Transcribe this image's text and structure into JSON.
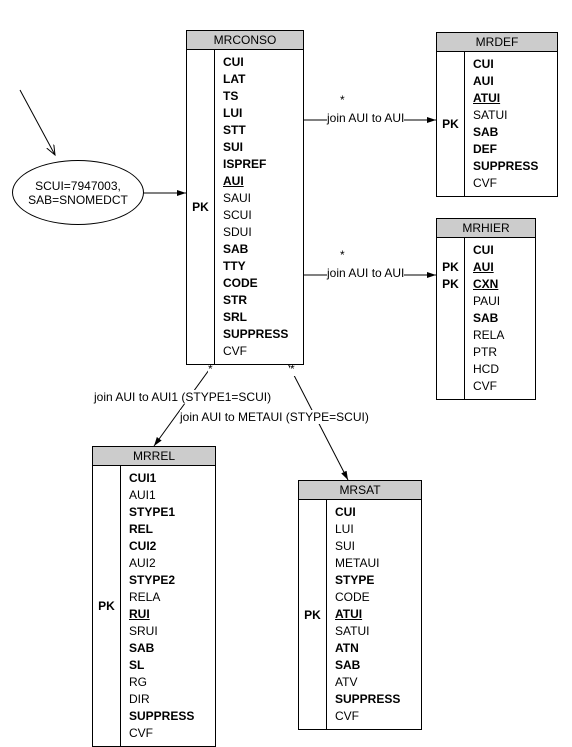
{
  "input": {
    "line1": "SCUI=7947003,",
    "line2": "SAB=SNOMEDCT"
  },
  "joins": {
    "mrdef": "join AUI to AUI",
    "mrhier": "join AUI to AUI",
    "mrrel": "join AUI to AUI1 (STYPE1=SCUI)",
    "mrsat": "join AUI to METAUI (STYPE=SCUI)"
  },
  "stars": {
    "top": "*",
    "mid": "*",
    "left": "*",
    "right": "*"
  },
  "entities": {
    "mrconso": {
      "title": "MRCONSO",
      "pk": "PK",
      "fields": [
        {
          "name": "CUI",
          "bold": true
        },
        {
          "name": "LAT",
          "bold": true
        },
        {
          "name": "TS",
          "bold": true
        },
        {
          "name": "LUI",
          "bold": true
        },
        {
          "name": "STT",
          "bold": true
        },
        {
          "name": "SUI",
          "bold": true
        },
        {
          "name": "ISPREF",
          "bold": true
        },
        {
          "name": "AUI",
          "bold": true,
          "underline": true
        },
        {
          "name": "SAUI"
        },
        {
          "name": "SCUI"
        },
        {
          "name": "SDUI"
        },
        {
          "name": "SAB",
          "bold": true
        },
        {
          "name": "TTY",
          "bold": true
        },
        {
          "name": "CODE",
          "bold": true
        },
        {
          "name": "STR",
          "bold": true
        },
        {
          "name": "SRL",
          "bold": true
        },
        {
          "name": "SUPPRESS",
          "bold": true
        },
        {
          "name": "CVF"
        }
      ]
    },
    "mrdef": {
      "title": "MRDEF",
      "pk": "PK",
      "fields": [
        {
          "name": "CUI",
          "bold": true
        },
        {
          "name": "AUI",
          "bold": true
        },
        {
          "name": "ATUI",
          "bold": true,
          "underline": true
        },
        {
          "name": "SATUI"
        },
        {
          "name": "SAB",
          "bold": true
        },
        {
          "name": "DEF",
          "bold": true
        },
        {
          "name": "SUPPRESS",
          "bold": true
        },
        {
          "name": "CVF"
        }
      ]
    },
    "mrhier": {
      "title": "MRHIER",
      "pk1": "PK",
      "pk2": "PK",
      "fields": [
        {
          "name": "CUI",
          "bold": true
        },
        {
          "name": "AUI",
          "bold": true,
          "underline": true
        },
        {
          "name": "CXN",
          "bold": true,
          "underline": true
        },
        {
          "name": "PAUI"
        },
        {
          "name": "SAB",
          "bold": true
        },
        {
          "name": "RELA"
        },
        {
          "name": "PTR"
        },
        {
          "name": "HCD"
        },
        {
          "name": "CVF"
        }
      ]
    },
    "mrrel": {
      "title": "MRREL",
      "pk": "PK",
      "fields": [
        {
          "name": "CUI1",
          "bold": true
        },
        {
          "name": "AUI1"
        },
        {
          "name": "STYPE1",
          "bold": true
        },
        {
          "name": "REL",
          "bold": true
        },
        {
          "name": "CUI2",
          "bold": true
        },
        {
          "name": "AUI2"
        },
        {
          "name": "STYPE2",
          "bold": true
        },
        {
          "name": "RELA"
        },
        {
          "name": "RUI",
          "bold": true,
          "underline": true
        },
        {
          "name": "SRUI"
        },
        {
          "name": "SAB",
          "bold": true
        },
        {
          "name": "SL",
          "bold": true
        },
        {
          "name": "RG"
        },
        {
          "name": "DIR"
        },
        {
          "name": "SUPPRESS",
          "bold": true
        },
        {
          "name": "CVF"
        }
      ]
    },
    "mrsat": {
      "title": "MRSAT",
      "pk": "PK",
      "fields": [
        {
          "name": "CUI",
          "bold": true
        },
        {
          "name": "LUI"
        },
        {
          "name": "SUI"
        },
        {
          "name": "METAUI"
        },
        {
          "name": "STYPE",
          "bold": true
        },
        {
          "name": "CODE"
        },
        {
          "name": "ATUI",
          "bold": true,
          "underline": true
        },
        {
          "name": "SATUI"
        },
        {
          "name": "ATN",
          "bold": true
        },
        {
          "name": "SAB",
          "bold": true
        },
        {
          "name": "ATV"
        },
        {
          "name": "SUPPRESS",
          "bold": true
        },
        {
          "name": "CVF"
        }
      ]
    }
  }
}
